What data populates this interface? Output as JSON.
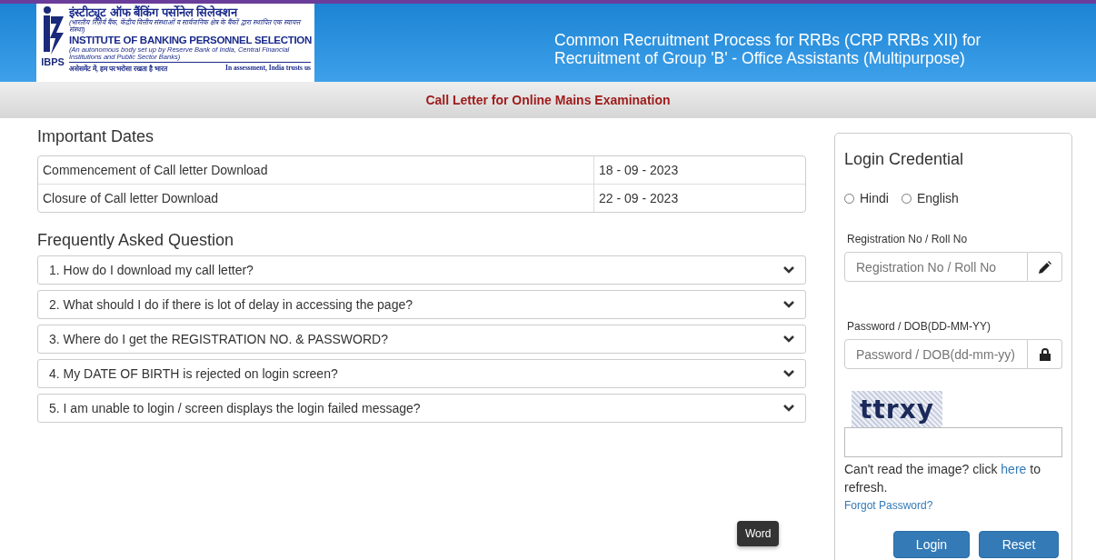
{
  "header": {
    "logo": {
      "hindi_name": "इंस्टीट्यूट ऑफ बैंकिंग पर्सोनेल सिलेक्शन",
      "hindi_subtitle": "(भारतीय रिज़र्व बैंक, केंद्रीय वित्तीय संस्थाओं व सार्वजनिक क्षेत्र के बैंकों द्वारा स्थापित एक स्वायत्त संस्था)",
      "english_name": "INSTITUTE OF BANKING PERSONNEL SELECTION",
      "english_subtitle": "(An autonomous body set up by Reserve Bank of India, Central Financial Institutions and Public Sector Banks)",
      "hindi_tagline": "असेसमेंट में, हम पर भरोसा रखता है भारत",
      "english_tagline": "In assessment, India trusts us",
      "abbr": "IBPS"
    },
    "title": "Common Recruitment Process for RRBs (CRP RRBs XII) for Recruitment of Group 'B' - Office Assistants (Multipurpose)"
  },
  "subheader": "Call Letter for Online Mains Examination",
  "important_dates": {
    "heading": "Important Dates",
    "rows": [
      {
        "event": "Commencement of Call letter Download",
        "date": "18 - 09 - 2023"
      },
      {
        "event": "Closure of Call letter Download",
        "date": "22 - 09 - 2023"
      }
    ]
  },
  "faq": {
    "heading": "Frequently Asked Question",
    "items": [
      {
        "question": "1. How do I download my call letter?",
        "expanded": false
      },
      {
        "question": "2. What should I do if there is lot of delay in accessing the page?",
        "expanded": false
      },
      {
        "question": "3. Where do I get the REGISTRATION NO. & PASSWORD?",
        "expanded": false
      },
      {
        "question": "4. My DATE OF BIRTH is rejected on login screen?",
        "expanded": false
      },
      {
        "question": "5. I am unable to login / screen displays the login failed message?",
        "expanded": false
      }
    ]
  },
  "login": {
    "heading": "Login Credential",
    "languages": [
      {
        "label": "Hindi",
        "selected": false
      },
      {
        "label": "English",
        "selected": false
      }
    ],
    "fields": [
      {
        "label": "Registration No / Roll No",
        "placeholder": "Registration No / Roll No",
        "kind": "text"
      },
      {
        "label": "Password / DOB(DD-MM-YY)",
        "placeholder": "Password / DOB(dd-mm-yy)",
        "kind": "password"
      }
    ],
    "captcha": "ttrxy",
    "refresh_before": "Can't read the image? click ",
    "refresh_link": "here",
    "refresh_after": " to refresh.",
    "forgot": "Forgot Password?",
    "buttons": [
      "Login",
      "Reset"
    ]
  },
  "tooltip": "Word"
}
